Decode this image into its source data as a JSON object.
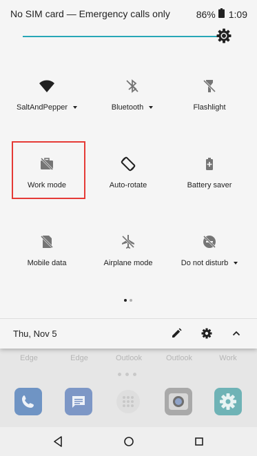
{
  "status_bar": {
    "carrier_text": "No SIM card — Emergency calls only",
    "battery_percent": "86%",
    "time": "1:09"
  },
  "brightness": {
    "level": 0.98,
    "accent_color": "#26a6b6"
  },
  "tiles": [
    {
      "label": "SaltAndPepper",
      "icon": "wifi-icon",
      "has_dropdown": true
    },
    {
      "label": "Bluetooth",
      "icon": "bluetooth-off-icon",
      "has_dropdown": true
    },
    {
      "label": "Flashlight",
      "icon": "flashlight-off-icon",
      "has_dropdown": false
    },
    {
      "label": "Work mode",
      "icon": "work-off-icon",
      "has_dropdown": false,
      "highlighted": true
    },
    {
      "label": "Auto-rotate",
      "icon": "auto-rotate-icon",
      "has_dropdown": false
    },
    {
      "label": "Battery saver",
      "icon": "battery-saver-icon",
      "has_dropdown": false
    },
    {
      "label": "Mobile data",
      "icon": "mobile-data-off-icon",
      "has_dropdown": false
    },
    {
      "label": "Airplane mode",
      "icon": "airplane-off-icon",
      "has_dropdown": false
    },
    {
      "label": "Do not disturb",
      "icon": "do-not-disturb-off-icon",
      "has_dropdown": true
    }
  ],
  "pager": {
    "pages": 2,
    "current": 1
  },
  "footer": {
    "date": "Thu, Nov 5",
    "buttons": [
      "edit-icon",
      "settings-icon",
      "collapse-icon"
    ]
  },
  "home_screen": {
    "app_labels": [
      "Edge",
      "Edge",
      "Outlook",
      "Outlook",
      "Work"
    ],
    "dock_icons": [
      "phone-app-icon",
      "messages-app-icon",
      "app-drawer-icon",
      "camera-app-icon",
      "settings-app-icon"
    ]
  },
  "nav_bar": {
    "buttons": [
      "back-icon",
      "home-icon",
      "recents-icon"
    ]
  },
  "highlight_color": "#e53935"
}
